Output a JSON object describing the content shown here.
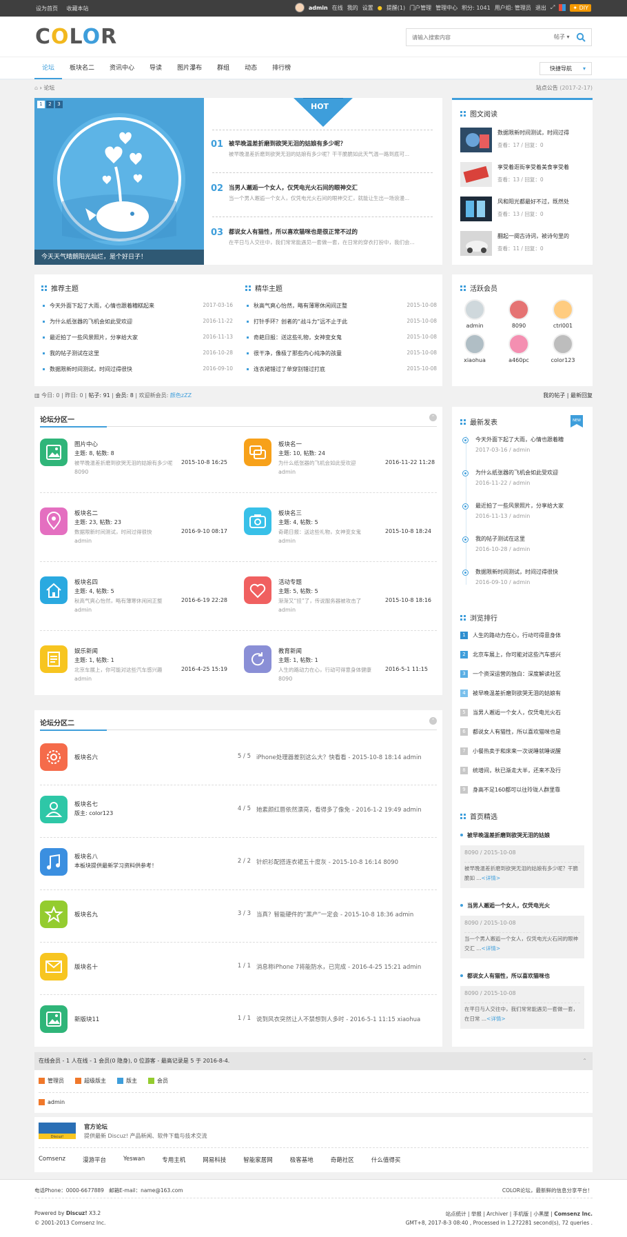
{
  "topbar": {
    "set_home": "设为首页",
    "bookmark": "收藏本站",
    "user": "admin",
    "status": "在线",
    "my": "我的",
    "settings": "设置",
    "remind": "提醒(1)",
    "portal": "门户管理",
    "admin_center": "管理中心",
    "credits": "积分: 1041",
    "usergroup": "用户组: 管理员",
    "logout": "退出",
    "diy": "DIY"
  },
  "header": {
    "logo": [
      "C",
      "O",
      "L",
      "O",
      "R"
    ],
    "search_placeholder": "请输入搜索内容",
    "search_type": "帖子"
  },
  "nav": {
    "items": [
      "论坛",
      "板块名二",
      "资讯中心",
      "导读",
      "图片瀑布",
      "群组",
      "动态",
      "排行榜"
    ],
    "quick": "快捷导航"
  },
  "crumb": {
    "here": "论坛",
    "notice": "站点公告",
    "notice_date": "(2017-2-17)"
  },
  "slider": {
    "pages": [
      "1",
      "2",
      "3"
    ],
    "caption": "今天天气晴朗阳光灿烂，是个好日子！"
  },
  "hot": {
    "badge": "HOT",
    "items": [
      {
        "num": "01",
        "title": "被早晚温差折磨到欲哭无泪的姑娘有多少呢？",
        "desc": "被早晚温差折磨到欲哭无泪的姑娘有多少呢？干干脆脆如此天气温一路到底可..."
      },
      {
        "num": "02",
        "title": "当男人邂逅一个女人，仅凭电光火石间的眼神交汇",
        "desc": "当一个男人邂逅一个女人，仅凭电光火石间的眼神交汇，就能让生出一场浪漫..."
      },
      {
        "num": "03",
        "title": "都说女人有猫性，所以喜欢猫咪也是很正常不过的",
        "desc": "在平日与人交往中，我们常常能遇见一套做一套，在日常的穿衣打扮中，我们会..."
      }
    ]
  },
  "read": {
    "title": "图文阅读",
    "items": [
      {
        "title": "数据限新时间测试，时间过得",
        "meta": "查看：17 / 回复：0"
      },
      {
        "title": "享受着逛街享受着美食享受着",
        "meta": "查看：13 / 回复：0"
      },
      {
        "title": "风和阳光都最好不过，既然处",
        "meta": "查看：13 / 回复：0"
      },
      {
        "title": "翻起一阕古诗词，被诗句里的",
        "meta": "查看：11 / 回复：0"
      }
    ]
  },
  "recommend": {
    "title": "推荐主题",
    "items": [
      {
        "t": "今天外面下起了大雨，心情也跟着糟糕起来",
        "d": "2017-03-16"
      },
      {
        "t": "为什么纸张器的飞机会如此受欢迎",
        "d": "2016-11-22"
      },
      {
        "t": "最近拍了一些风景照片，分享给大家",
        "d": "2016-11-13"
      },
      {
        "t": "我的帖子测试在这里",
        "d": "2016-10-28"
      },
      {
        "t": "数据限新时间测试，时间过得很快",
        "d": "2016-09-10"
      }
    ]
  },
  "digest": {
    "title": "精华主题",
    "items": [
      {
        "t": "秋高气爽心怡然，略有薄寒休闲间正整",
        "d": "2015-10-08"
      },
      {
        "t": "打针手环？创者的“战斗力”远不止于此",
        "d": "2015-10-08"
      },
      {
        "t": "奇葩日报：送这些礼物，女神变女鬼",
        "d": "2015-10-08"
      },
      {
        "t": "很干净，像极了那些内心纯净的孩童",
        "d": "2015-10-08"
      },
      {
        "t": "连衣裙错过了单穿别错过打底",
        "d": "2015-10-08"
      }
    ]
  },
  "members": {
    "title": "活跃会员",
    "items": [
      {
        "n": "admin",
        "c": "#cfd8dc"
      },
      {
        "n": "8090",
        "c": "#e57373"
      },
      {
        "n": "ctrl001",
        "c": "#ffcc80"
      },
      {
        "n": "xiaohua",
        "c": "#b0bec5"
      },
      {
        "n": "a460pc",
        "c": "#f48fb1"
      },
      {
        "n": "color123",
        "c": "#bdbdbd"
      }
    ]
  },
  "stats": {
    "today": "今日: 0",
    "yesterday": "昨日: 0",
    "posts": "帖子: 91",
    "members": "会员: 8",
    "welcome": "欢迎新会员:",
    "newest": "颜色zZZ",
    "my_posts": "我的帖子",
    "latest_reply": "最新回复"
  },
  "sec1": {
    "title": "论坛分区一",
    "forums": [
      {
        "name": "图片中心",
        "stat": "主题: 8, 帖数: 8",
        "last": "被早晚温差折磨到欲哭无泪的姑娘有多少呢",
        "time": "2015-10-8 16:25",
        "author": "8090",
        "color": "#2fb579",
        "icon": "image"
      },
      {
        "name": "板块名一",
        "stat": "主题: 10, 帖数: 24",
        "last": "为什么纸张器的飞机会如此受欢迎",
        "time": "2016-11-22 11:28",
        "author": "admin",
        "color": "#f7a11a",
        "icon": "chat"
      },
      {
        "name": "板块名二",
        "stat": "主题: 23, 帖数: 23",
        "last": "数据限新时间测试，时间过得很快",
        "time": "2016-9-10 08:17",
        "author": "admin",
        "color": "#e46fc0",
        "icon": "pin"
      },
      {
        "name": "板块名三",
        "stat": "主题: 4, 帖数: 5",
        "last": "奇葩日报：送这些礼物，女神变女鬼",
        "time": "2015-10-8 18:24",
        "author": "admin",
        "color": "#38c0e8",
        "icon": "camera"
      },
      {
        "name": "板块名四",
        "stat": "主题: 4, 帖数: 5",
        "last": "秋高气爽心怡然，略有薄寒休闲间正整",
        "time": "2016-6-19 22:28",
        "author": "admin",
        "color": "#2aa9e0",
        "icon": "home"
      },
      {
        "name": "活动专题",
        "stat": "主题: 5, 帖数: 5",
        "last": "渐渐又“挂”了，传说服务器被攻击了",
        "time": "2015-10-8 18:16",
        "author": "admin",
        "color": "#f06060",
        "icon": "heart"
      },
      {
        "name": "娱乐新闻",
        "stat": "主题: 1, 帖数: 1",
        "last": "北京车展上，你可能对这些汽车感兴趣",
        "time": "2016-4-25 15:19",
        "author": "admin",
        "color": "#f7c520",
        "icon": "doc"
      },
      {
        "name": "教育新闻",
        "stat": "主题: 1, 帖数: 1",
        "last": "人生的路动力在心，行动可得意身体健康",
        "time": "2016-5-1 11:15",
        "author": "8090",
        "color": "#8a8fd6",
        "icon": "refresh"
      }
    ]
  },
  "sec2": {
    "title": "论坛分区二",
    "forums": [
      {
        "name": "板块名六",
        "mod": "",
        "cnt": "5 / 5",
        "last": "iPhone处理器差别这么大？快看看 - 2015-10-8 18:14 admin",
        "color": "#f56b4a",
        "icon": "gear"
      },
      {
        "name": "板块名七",
        "mod": "版主: color123",
        "cnt": "4 / 5",
        "last": "她素颜红唇依然漂亮，看得多了像免 - 2016-1-2 19:49 admin",
        "color": "#2ec7a7",
        "icon": "user"
      },
      {
        "name": "板块名八",
        "mod": "本板块提供最新学习资料供参考！",
        "cnt": "2 / 2",
        "last": "针织衫配搭连衣裙五十度灰 - 2015-10-8 16:14 8090",
        "color": "#3b8fe0",
        "icon": "music"
      },
      {
        "name": "板块名九",
        "mod": "",
        "cnt": "3 / 3",
        "last": "当真？智能硬件的“黑产”一定会 - 2015-10-8 18:36 admin",
        "color": "#94cc2f",
        "icon": "star"
      },
      {
        "name": "版块名十",
        "mod": "",
        "cnt": "1 / 1",
        "last": "消息称iPhone 7将能防水，已完成 - 2016-4-25 15:21 admin",
        "color": "#f7c520",
        "icon": "mail"
      },
      {
        "name": "新版块11",
        "mod": "",
        "cnt": "1 / 1",
        "last": "说到风衣突然让人不禁想到人多时 - 2016-5-1 11:15 xiaohua",
        "color": "#2fb579",
        "icon": "image"
      }
    ]
  },
  "latest": {
    "title": "最新发表",
    "badge": "NEW",
    "items": [
      {
        "t": "今天外面下起了大雨，心情也跟着糟",
        "d": "2017-03-16 / admin"
      },
      {
        "t": "为什么纸张器的飞机会如此受欢迎",
        "d": "2016-11-22 / admin"
      },
      {
        "t": "最近拍了一些风景照片，分享给大家",
        "d": "2016-11-13 / admin"
      },
      {
        "t": "我的帖子测试在这里",
        "d": "2016-10-28 / admin"
      },
      {
        "t": "数据限新时间测试，时间过得很快",
        "d": "2016-09-10 / admin"
      }
    ]
  },
  "ranking": {
    "title": "浏览排行",
    "items": [
      {
        "n": "1",
        "t": "人生的路动力在心，行动可得意身体"
      },
      {
        "n": "2",
        "t": "北京车展上，你可能对这些汽车感兴"
      },
      {
        "n": "3",
        "t": "一个资深运营的独白：深度解读社区"
      },
      {
        "n": "4",
        "t": "被早晚温差折磨到欲哭无泪的姑娘有"
      },
      {
        "n": "5",
        "t": "当男人邂逅一个女人，仅凭电光火石"
      },
      {
        "n": "6",
        "t": "都说女人有猫性，所以喜欢猫咪也是"
      },
      {
        "n": "7",
        "t": "小餐热卖于和床来一次说睡就睡说醒"
      },
      {
        "n": "8",
        "t": "统增间，秋已渐走大半，还来不及行"
      },
      {
        "n": "9",
        "t": "身高不足160都可以往玲珑人群里靠"
      }
    ],
    "colors": [
      "#2f8fd0",
      "#3e9edb",
      "#5aaee4",
      "#7ac0ec",
      "#c8c8c8",
      "#c8c8c8",
      "#c8c8c8",
      "#c8c8c8",
      "#c8c8c8"
    ]
  },
  "picks": {
    "title": "首页精选",
    "items": [
      {
        "t": "被早晚温差折磨到欲哭无泪的姑娘",
        "m": "8090 / 2015-10-08",
        "x": "被早晚温差折磨到欲哭无泪的姑娘有多少呢？干脆脆如 ...",
        "more": "<详情>"
      },
      {
        "t": "当男人邂逅一个女人，仅凭电光火",
        "m": "8090 / 2015-10-08",
        "x": "当一个男人邂逅一个女人，仅凭电光火石间的眼神交汇 ...",
        "more": "<详情>"
      },
      {
        "t": "都说女人有猫性，所以喜欢猫咪也",
        "m": "8090 / 2015-10-08",
        "x": "在平日与人交往中，我们常常能遇见一套做一套，在日常 ...",
        "more": "<详情>"
      }
    ]
  },
  "online": {
    "header": "在线会员 - 1 人在线 - 1 会员(0 隐身), 0 位游客 - 最高记录是 5 于 2016-8-4.",
    "legend": [
      {
        "n": "管理员",
        "c": "#f0782a"
      },
      {
        "n": "超级版主",
        "c": "#f0782a"
      },
      {
        "n": "版主",
        "c": "#3e9edb"
      },
      {
        "n": "会员",
        "c": "#94cc2f"
      }
    ],
    "user": "admin"
  },
  "links": {
    "name": "官方论坛",
    "desc": "提供最新 Discuz! 产品新闻、软件下载与技术交流",
    "logo": "Discuz!",
    "items": [
      "Comsenz",
      "漫游平台",
      "Yeswan",
      "专用主机",
      "网易科技",
      "智能家居网",
      "极客基地",
      "奇葩社区",
      "什么值得买"
    ]
  },
  "footer": {
    "phone": "电话Phone：0000-6677889",
    "email": "邮箱E-mail：name@163.com",
    "slogan": "COLOR论坛，最新鲜的信息分享平台！",
    "powered": "Powered by",
    "brand": "Discuz!",
    "ver": "X3.2",
    "copy": "© 2001-2013 Comsenz Inc.",
    "right_links": "站点统计 | 举报 | Archiver | 手机版 | 小黑屋 |",
    "company": "Comsenz Inc.",
    "proc": "GMT+8, 2017-8-3 08:40 , Processed in 1.272281 second(s), 72 queries ."
  }
}
